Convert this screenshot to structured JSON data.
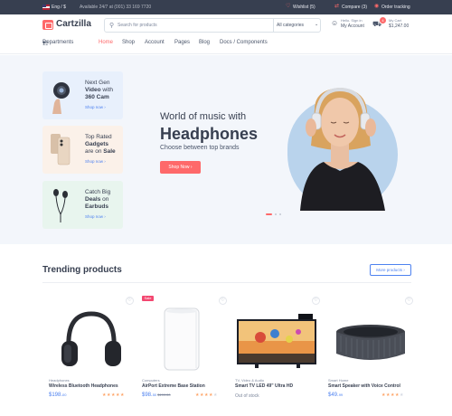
{
  "topbar": {
    "language": "Eng / $",
    "availability": "Available 24/7 at (001) 33 169 7720",
    "wishlist": "Wishlist (5)",
    "compare": "Compare (3)",
    "tracking": "Order tracking"
  },
  "header": {
    "logo": "Cartzilla",
    "search_placeholder": "Search for products",
    "category_select": "All categories",
    "account_greeting": "Hello, Sign in",
    "account_label": "My Account",
    "cart_label": "My Cart",
    "cart_total": "$1,247.00",
    "cart_count": "4"
  },
  "menu": {
    "departments": "Departments",
    "items": [
      "Home",
      "Shop",
      "Account",
      "Pages",
      "Blog",
      "Docs / Components"
    ],
    "active_index": 0
  },
  "promos": [
    {
      "line1": "Next Gen",
      "line2_bold": "Video",
      "line2_rest": " with",
      "line3_bold": "360 Cam",
      "line3_pre": "",
      "link": "Shop now",
      "bg": "#e8f0fc"
    },
    {
      "line1": "Top Rated",
      "line2_bold": "Gadgets",
      "line2_rest": "",
      "line3_pre": "are on ",
      "line3_bold": "Sale",
      "link": "Shop now",
      "bg": "#fbf1e9"
    },
    {
      "line1": "Catch Big",
      "line2_bold": "Deals",
      "line2_rest": " on",
      "line3_pre": "",
      "line3_bold": "Earbuds",
      "link": "Shop now",
      "bg": "#e8f5ee"
    }
  ],
  "hero": {
    "kicker": "World of music with",
    "headline": "Headphones",
    "subtitle": "Choose between top brands",
    "button": "Shop Now",
    "slide_active": 1,
    "slide_count": 3
  },
  "trending": {
    "title": "Trending products",
    "more": "More products",
    "products": [
      {
        "category": "Headphones",
        "name": "Wireless Bluetooth Headphones",
        "price": "$198.",
        "cents": "00",
        "old_price": "",
        "rating": 5,
        "in_stock": true,
        "sale": false
      },
      {
        "category": "Computers",
        "name": "AirPort Extreme Base Station",
        "price": "$98.",
        "cents": "50",
        "old_price": "$199.00",
        "rating": 4,
        "in_stock": true,
        "sale": true
      },
      {
        "category": "TV, Video & Audio",
        "name": "Smart TV LED 49\" Ultra HD",
        "price": "",
        "cents": "",
        "old_price": "",
        "rating": 0,
        "in_stock": false,
        "stock_label": "Out of stock",
        "sale": false
      },
      {
        "category": "Smart Home",
        "name": "Smart Speaker with Voice Control",
        "price": "$49.",
        "cents": "99",
        "old_price": "",
        "rating": 4,
        "in_stock": true,
        "sale": false
      }
    ],
    "sale_label": "Sale"
  },
  "colors": {
    "accent": "#fe696a",
    "link": "#4e82f0",
    "dark": "#373f50",
    "star": "#fea569"
  }
}
